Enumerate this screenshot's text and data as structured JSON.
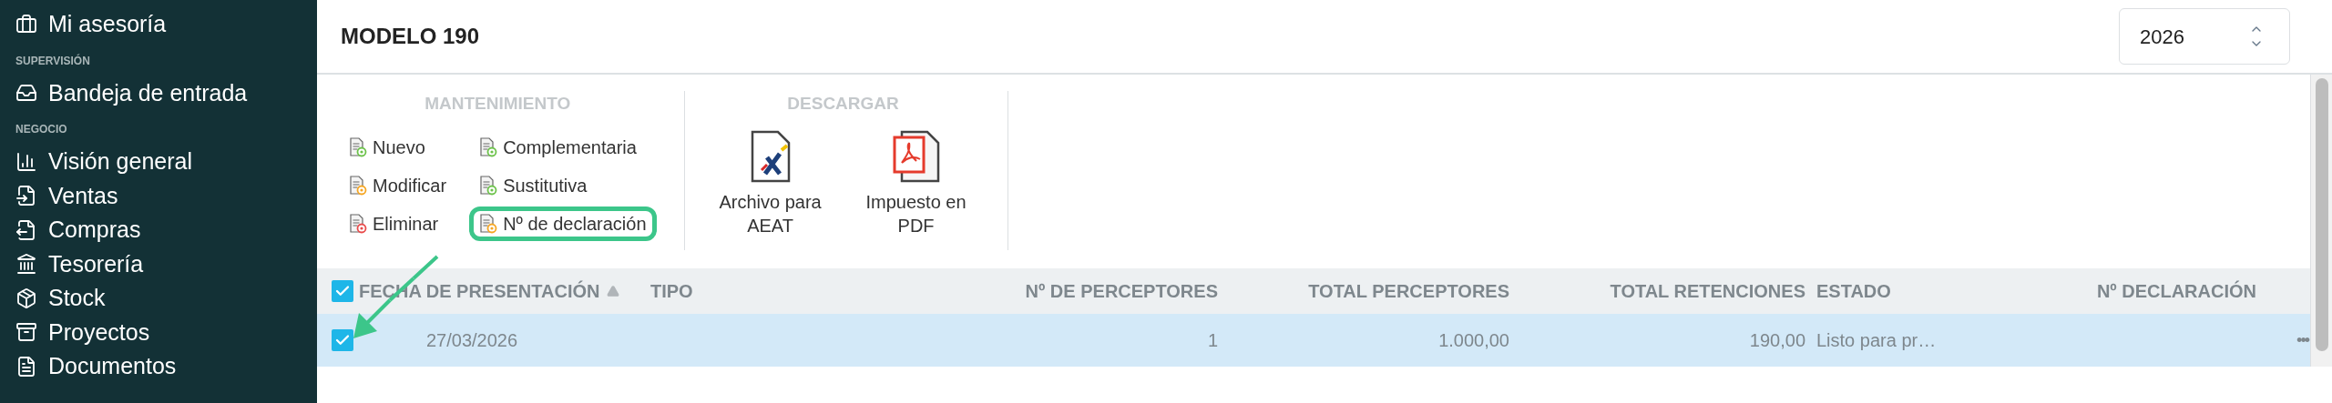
{
  "sidebar": {
    "items": [
      {
        "kind": "link",
        "label": "Mi asesoría"
      },
      {
        "kind": "section",
        "label": "SUPERVISIÓN"
      },
      {
        "kind": "link",
        "label": "Bandeja de entrada"
      },
      {
        "kind": "section",
        "label": "NEGOCIO"
      },
      {
        "kind": "link",
        "label": "Visión general"
      },
      {
        "kind": "link",
        "label": "Ventas"
      },
      {
        "kind": "link",
        "label": "Compras"
      },
      {
        "kind": "link",
        "label": "Tesorería"
      },
      {
        "kind": "link",
        "label": "Stock"
      },
      {
        "kind": "link",
        "label": "Proyectos"
      },
      {
        "kind": "link",
        "label": "Documentos"
      }
    ]
  },
  "header": {
    "title": "MODELO 190",
    "year_select": {
      "value": "2026"
    }
  },
  "toolbar": {
    "groups": [
      {
        "title": "MANTENIMIENTO",
        "kind": "small",
        "columns": [
          [
            {
              "label": "Nuevo",
              "kind": "add",
              "highlighted": false
            },
            {
              "label": "Modificar",
              "kind": "edit",
              "highlighted": false
            },
            {
              "label": "Eliminar",
              "kind": "delete",
              "highlighted": false
            }
          ],
          [
            {
              "label": "Complementaria",
              "kind": "add",
              "highlighted": false
            },
            {
              "label": "Sustitutiva",
              "kind": "add",
              "highlighted": false
            },
            {
              "label": "Nº de declaración",
              "kind": "edit",
              "highlighted": true
            }
          ]
        ]
      },
      {
        "title": "DESCARGAR",
        "kind": "large",
        "buttons": [
          {
            "label": "Archivo para AEAT",
            "kind": "aeat"
          },
          {
            "label": "Impuesto en PDF",
            "kind": "pdf"
          }
        ]
      }
    ]
  },
  "table": {
    "select_all": {
      "checked": true
    },
    "columns": [
      {
        "label": "FECHA DE PRESENTACIÓN",
        "sorted": true
      },
      {
        "label": "TIPO",
        "sorted": false
      },
      {
        "label": "Nº DE PERCEPTORES",
        "sorted": false
      },
      {
        "label": "TOTAL PERCEPTORES",
        "sorted": false
      },
      {
        "label": "TOTAL RETENCIONES",
        "sorted": false
      },
      {
        "label": "ESTADO",
        "sorted": false
      },
      {
        "label": "Nº DECLARACIÓN",
        "sorted": false
      }
    ],
    "rows": [
      {
        "selected": true,
        "checked": true,
        "cells": [
          "27/03/2026",
          "",
          "1",
          "1.000,00",
          "190,00",
          "Listo para pr…",
          ""
        ],
        "menu": "•••"
      }
    ]
  }
}
